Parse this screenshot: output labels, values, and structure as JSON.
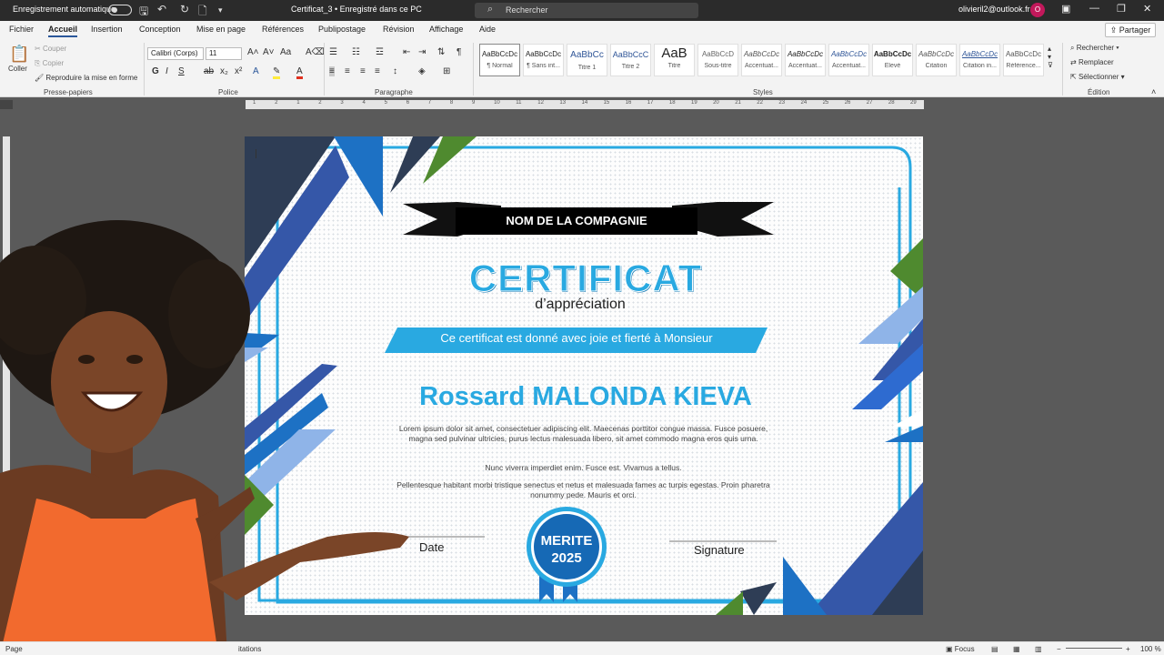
{
  "titlebar": {
    "autosave_label": "Enregistrement automatique",
    "doc_title": "Certificat_3 • Enregistré dans ce PC",
    "search_placeholder": "Rechercher",
    "account": "olivieril2@outlook.fr",
    "avatar_initial": "O"
  },
  "menu": {
    "tabs": [
      "Fichier",
      "Accueil",
      "Insertion",
      "Conception",
      "Mise en page",
      "Références",
      "Publipostage",
      "Révision",
      "Affichage",
      "Aide"
    ],
    "share_label": "Partager"
  },
  "ribbon": {
    "clipboard": {
      "paste": "Coller",
      "cut": "Couper",
      "copy": "Copier",
      "format_painter": "Reproduire la mise en forme",
      "label": "Presse-papiers"
    },
    "font": {
      "family": "Calibri (Corps)",
      "size": "11",
      "label": "Police"
    },
    "paragraph": {
      "label": "Paragraphe"
    },
    "styles": {
      "label": "Styles",
      "items": [
        {
          "preview": "AaBbCcDc",
          "name": "¶ Normal"
        },
        {
          "preview": "AaBbCcDc",
          "name": "¶ Sans int..."
        },
        {
          "preview": "AaBbCc",
          "name": "Titre 1"
        },
        {
          "preview": "AaBbCcC",
          "name": "Titre 2"
        },
        {
          "preview": "AaB",
          "name": "Titre"
        },
        {
          "preview": "AaBbCcD",
          "name": "Sous-titre"
        },
        {
          "preview": "AaBbCcDc",
          "name": "Accentuat..."
        },
        {
          "preview": "AaBbCcDc",
          "name": "Accentuat..."
        },
        {
          "preview": "AaBbCcDc",
          "name": "Accentuat..."
        },
        {
          "preview": "AaBbCcDc",
          "name": "Élevé"
        },
        {
          "preview": "AaBbCcDc",
          "name": "Citation"
        },
        {
          "preview": "AaBbCcDc",
          "name": "Citation in..."
        },
        {
          "preview": "AaBbCcDc",
          "name": "Référence..."
        }
      ]
    },
    "editing": {
      "find": "Rechercher",
      "replace": "Remplacer",
      "select": "Sélectionner",
      "label": "Édition"
    }
  },
  "ruler": {
    "numbers": [
      "1",
      "2",
      "1",
      "2",
      "3",
      "4",
      "5",
      "6",
      "7",
      "8",
      "9",
      "10",
      "11",
      "12",
      "13",
      "14",
      "15",
      "16",
      "17",
      "18",
      "19",
      "20",
      "21",
      "22",
      "23",
      "24",
      "25",
      "26",
      "27",
      "28",
      "29"
    ]
  },
  "certificate": {
    "company": "NOM DE LA COMPAGNIE",
    "title": "CERTIFICAT",
    "subtitle": "d’appréciation",
    "given_to": "Ce certificat est donné avec joie et fierté à Monsieur",
    "recipient": "Rossard MALONDA KIEVA",
    "paragraph_1": "Lorem ipsum dolor sit amet, consectetuer adipiscing elit. Maecenas porttitor congue massa. Fusce posuere, magna sed pulvinar ultricies, purus lectus malesuada libero, sit amet commodo magna eros quis urna.",
    "paragraph_2": "Nunc viverra imperdiet enim. Fusce est. Vivamus a tellus.",
    "paragraph_3": "Pellentesque habitant morbi tristique senectus et netus et malesuada fames ac turpis egestas. Proin pharetra nonummy pede. Mauris et orci.",
    "date_label": "Date",
    "signature_label": "Signature",
    "medal_line1": "MERITE",
    "medal_line2": "2025"
  },
  "statusbar": {
    "page": "Page",
    "words": "itations",
    "focus": "Focus",
    "zoom": "100 %"
  },
  "colors": {
    "accent": "#29a9e1",
    "navy": "#2e3d55",
    "royal": "#3557a8",
    "green": "#4f8a2f",
    "word_blue": "#2b579a"
  }
}
